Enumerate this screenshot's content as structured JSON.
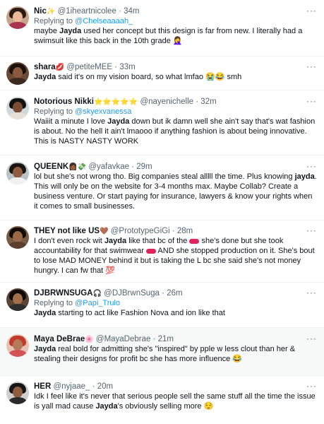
{
  "tweets": [
    {
      "name": "Nic",
      "name_emoji": "✨",
      "handle": "@1iheartnicolee",
      "time": "34m",
      "replying_prefix": "Replying to",
      "replying_to": "@Chelseaaaah_",
      "text_a": "maybe ",
      "bold": "Jayda",
      "text_b": " used her concept but this design is far from new. I literally had a swimsuit like this back in the 10th grade 🤦‍♀️"
    },
    {
      "name": "shara",
      "name_emoji": "💋",
      "handle": "@petiteMEE",
      "time": "33m",
      "text_a": "",
      "bold": "Jayda",
      "text_b": " said it's on my vision board, so what lmfao 😭😂 smh"
    },
    {
      "name": "Notorious Nikki",
      "name_emoji": "⭐⭐⭐⭐⭐",
      "handle": "@nayenichelle",
      "time": "32m",
      "replying_prefix": "Replying to",
      "replying_to": "@skyexvanessa",
      "text_a": "Waiiit a minute I love ",
      "bold": "Jayda",
      "text_b": " down but ik damn well she ain't say that's wat fashion is about. No the hell it ain't lmaooo if anything fashion is about being innovative. This is NASTY NASTY WORK"
    },
    {
      "name": "QUEENK",
      "name_emoji": "👩🏾💸",
      "handle": "@yafavkae",
      "time": "29m",
      "text_a": "lol but she's not wrong tho. Big companies steal alllll the time. Plus knowing ",
      "bold": "jayda",
      "text_b": ". This will only be on the website for 3-4 months max. Maybe Collab? Create a business venture. Or start paying for insurance, lawyers & know your rights when it comes to small businesses."
    },
    {
      "name": "THEY not like US",
      "name_emoji": "🤎",
      "handle": "@PrototypeGiGi",
      "time": "28m",
      "text_a": "I don't even rock wit ",
      "bold": "Jayda",
      "text_b": " like that bc of the",
      "text_c": " she's done but she took accountability for that swimwear",
      "text_d": " AND she stopped production on it. She's bout to lose MAD MONEY behind it but is taking the L bc she said she's not money hungry. I can fw that 💯"
    },
    {
      "name": "DJBRWNSUGA",
      "name_emoji": "🎧",
      "handle": "@DJBrwnSuga",
      "time": "26m",
      "replying_prefix": "Replying to",
      "replying_to": "@Papi_Trulo",
      "text_a": "",
      "bold": "Jayda",
      "text_b": " starting to act like Fashion Nova and ion like that"
    },
    {
      "name": "Maya DeBrae",
      "name_emoji": "🌸",
      "handle": "@MayaDebrae",
      "time": "21m",
      "text_a": "",
      "bold": "Jayda",
      "text_b": " real bold for admitting she's \"inspired\" by pple w less clout than her & stealing their designs for profit bc she has more influence 😂"
    },
    {
      "name": "HER",
      "name_emoji": "",
      "handle": "@nyjaae_",
      "time": "20m",
      "text_a": "Idk I feel like it's never that serious people sell the same stuff all the time the issue is yall mad cause ",
      "bold": "Jayda",
      "text_b": "'s obviously selling more 😌"
    }
  ],
  "separator": " · ",
  "more_icon": "···"
}
